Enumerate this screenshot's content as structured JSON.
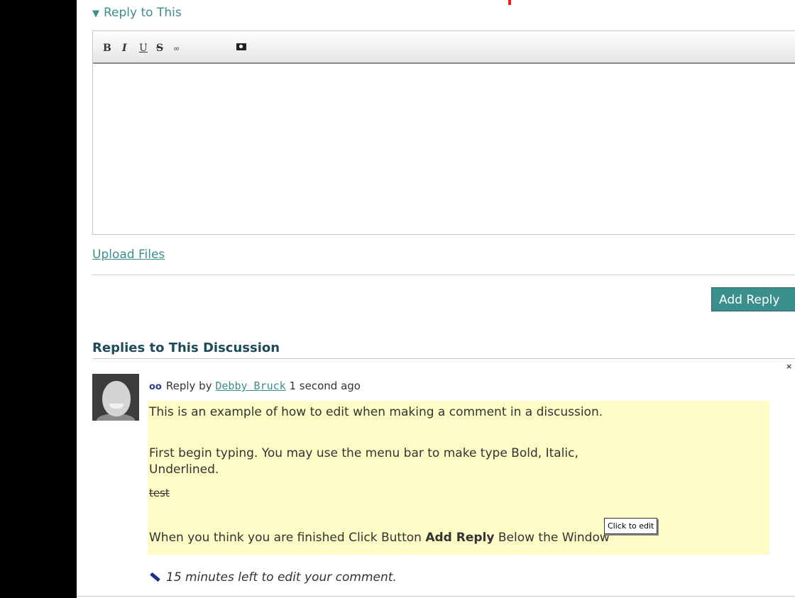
{
  "reply_toggle": {
    "arrow": "▼",
    "label": "Reply to This"
  },
  "toolbar": {
    "bold": "B",
    "italic": "I",
    "underline": "U",
    "strike": "S",
    "link": "∞"
  },
  "upload": {
    "label": "Upload Files"
  },
  "add_reply": {
    "label": "Add Reply"
  },
  "replies": {
    "section_title": "Replies to This Discussion",
    "close": "×",
    "items": [
      {
        "meta_prefix": "Reply by",
        "author": "Debby Bruck",
        "time": "1 second ago",
        "lines": [
          "This is an example of how to edit when making a comment in a discussion.",
          "First begin typing. You may use the menu bar to make type Bold, Italic,",
          "Underlined.",
          "test"
        ],
        "final_prefix": "When you think you are finished Click Button",
        "final_bold": "Add Reply",
        "final_suffix": "Below the Window",
        "tooltip": "Click to edit",
        "edit_time_left": "15 minutes left to edit your comment."
      }
    ]
  },
  "colors": {
    "accent": "#3a8f8c",
    "highlight": "#fdfbc6",
    "title": "#1e4a5a"
  }
}
